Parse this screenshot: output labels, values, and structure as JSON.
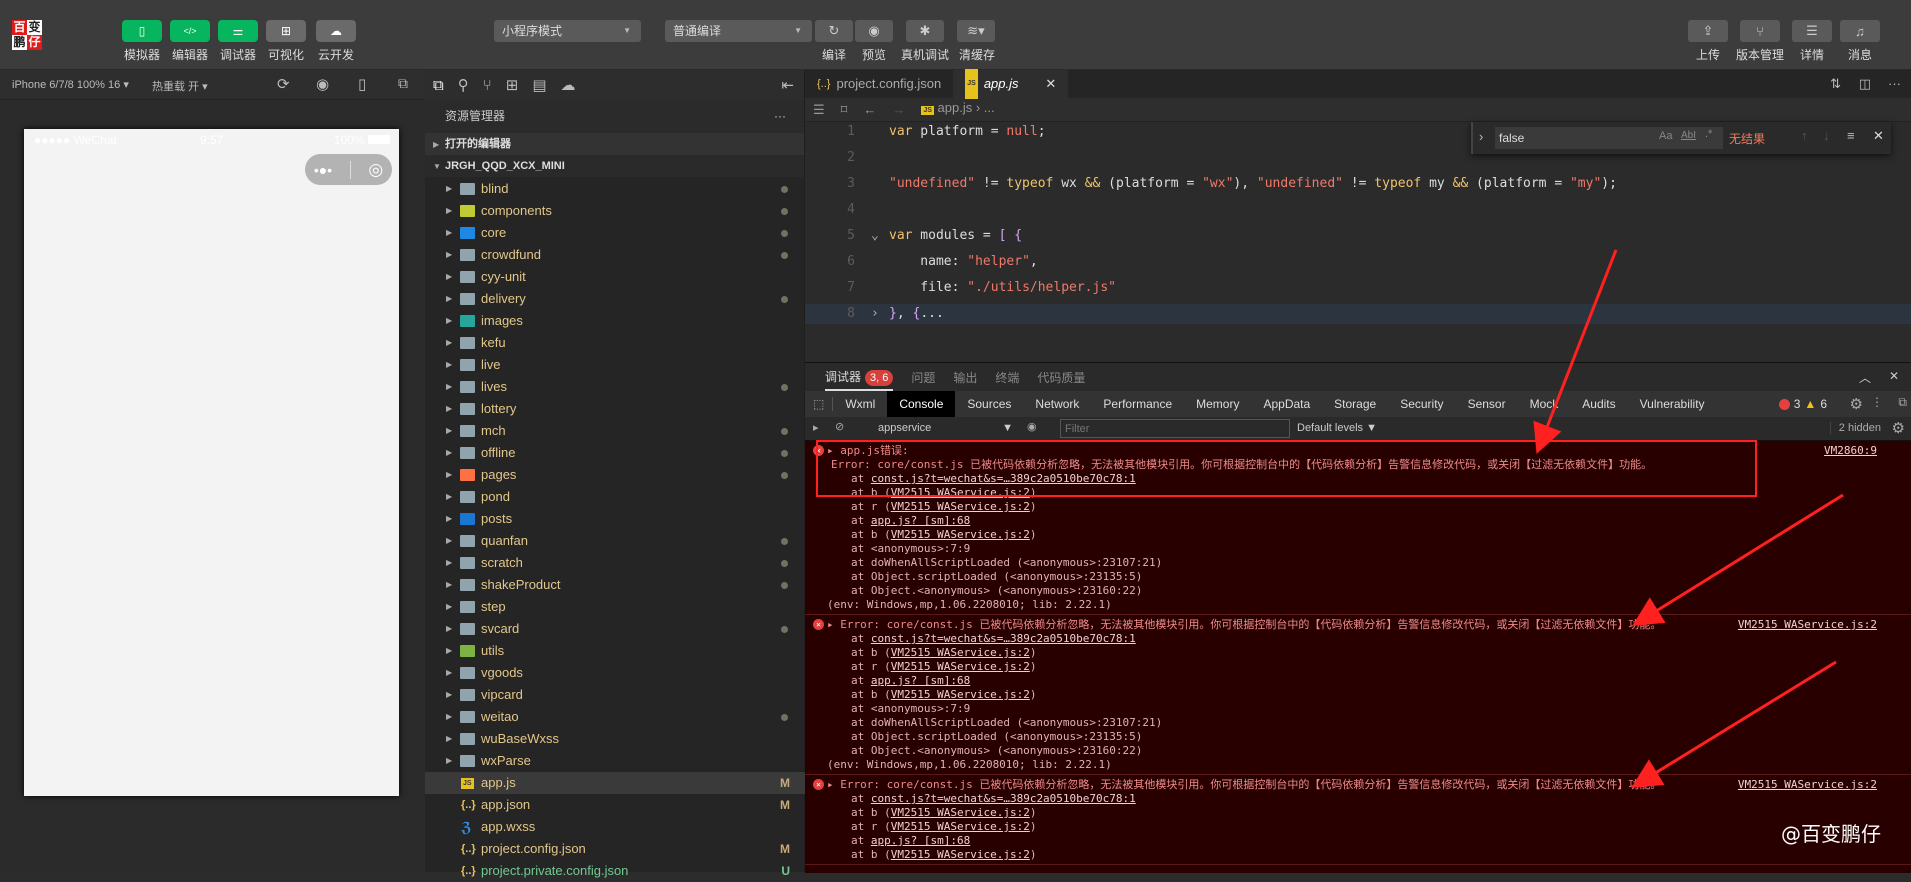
{
  "toolbar": {
    "logo_chars": [
      "百",
      "变",
      "鹏",
      "仔"
    ],
    "left_buttons": [
      {
        "label": "模拟器",
        "icon": "phone-icon",
        "style": "green"
      },
      {
        "label": "编辑器",
        "icon": "code-icon",
        "style": "green"
      },
      {
        "label": "调试器",
        "icon": "sliders-icon",
        "style": "green"
      },
      {
        "label": "可视化",
        "icon": "layout-icon",
        "style": "gray"
      },
      {
        "label": "云开发",
        "icon": "cloud-icon",
        "style": "gray"
      }
    ],
    "mode_select": "小程序模式",
    "compile_select": "普通编译",
    "center_buttons": [
      {
        "label": "编译",
        "icon": "refresh-icon"
      },
      {
        "label": "预览",
        "icon": "eye-icon"
      },
      {
        "label": "真机调试",
        "icon": "bug-icon"
      },
      {
        "label": "清缓存",
        "icon": "layers-icon"
      }
    ],
    "right_buttons": [
      {
        "label": "上传",
        "icon": "upload-icon"
      },
      {
        "label": "版本管理",
        "icon": "branch-icon"
      },
      {
        "label": "详情",
        "icon": "menu-icon"
      },
      {
        "label": "消息",
        "icon": "bell-icon"
      }
    ]
  },
  "simulator": {
    "device": "iPhone 6/7/8 100% 16",
    "hot_reload": "热重载 开",
    "status_carrier": "●●●●● WeChat",
    "status_time": "9:57",
    "status_battery": "100%"
  },
  "explorer": {
    "title": "资源管理器",
    "more": "···",
    "open_editors": "打开的编辑器",
    "project": "JRGH_QQD_XCX_MINI",
    "items": [
      {
        "name": "blind",
        "type": "folder",
        "dot": true
      },
      {
        "name": "components",
        "type": "folder-components",
        "dot": true
      },
      {
        "name": "core",
        "type": "folder-core",
        "dot": true
      },
      {
        "name": "crowdfund",
        "type": "folder",
        "dot": true
      },
      {
        "name": "cyy-unit",
        "type": "folder",
        "dot": false
      },
      {
        "name": "delivery",
        "type": "folder",
        "dot": true
      },
      {
        "name": "images",
        "type": "folder-images",
        "dot": false
      },
      {
        "name": "kefu",
        "type": "folder",
        "dot": false
      },
      {
        "name": "live",
        "type": "folder",
        "dot": false
      },
      {
        "name": "lives",
        "type": "folder",
        "dot": true
      },
      {
        "name": "lottery",
        "type": "folder",
        "dot": false
      },
      {
        "name": "mch",
        "type": "folder",
        "dot": true
      },
      {
        "name": "offline",
        "type": "folder",
        "dot": true
      },
      {
        "name": "pages",
        "type": "folder-pages",
        "dot": true
      },
      {
        "name": "pond",
        "type": "folder",
        "dot": false
      },
      {
        "name": "posts",
        "type": "folder-posts",
        "dot": false
      },
      {
        "name": "quanfan",
        "type": "folder",
        "dot": true
      },
      {
        "name": "scratch",
        "type": "folder",
        "dot": true
      },
      {
        "name": "shakeProduct",
        "type": "folder",
        "dot": true
      },
      {
        "name": "step",
        "type": "folder",
        "dot": false
      },
      {
        "name": "svcard",
        "type": "folder",
        "dot": true
      },
      {
        "name": "utils",
        "type": "folder-utils",
        "dot": false
      },
      {
        "name": "vgoods",
        "type": "folder",
        "dot": false
      },
      {
        "name": "vipcard",
        "type": "folder",
        "dot": false
      },
      {
        "name": "weitao",
        "type": "folder",
        "dot": true
      },
      {
        "name": "wuBaseWxss",
        "type": "folder",
        "dot": false
      },
      {
        "name": "wxParse",
        "type": "folder",
        "dot": false
      },
      {
        "name": "app.js",
        "type": "js",
        "flag": "M",
        "selected": true
      },
      {
        "name": "app.json",
        "type": "json",
        "flag": "M"
      },
      {
        "name": "app.wxss",
        "type": "css",
        "flag": ""
      },
      {
        "name": "project.config.json",
        "type": "json",
        "flag": "M"
      },
      {
        "name": "project.private.config.json",
        "type": "json",
        "flag": "U"
      }
    ]
  },
  "editor": {
    "tabs": [
      {
        "label": "project.config.json",
        "icon": "json-file-icon",
        "active": false
      },
      {
        "label": "app.js",
        "icon": "js-file-icon",
        "active": true
      }
    ],
    "breadcrumb": [
      "app.js",
      "..."
    ],
    "find": {
      "value": "false",
      "result": "无结果",
      "opt_case": "Aa",
      "opt_word": "AbI",
      "opt_regex": ".*"
    },
    "lines": [
      {
        "n": "1",
        "tokens": [
          [
            "kw",
            "var"
          ],
          [
            "pun",
            " platform = "
          ],
          [
            "nul",
            "null"
          ],
          [
            "pun",
            ";"
          ]
        ]
      },
      {
        "n": "2",
        "tokens": []
      },
      {
        "n": "3",
        "tokens": [
          [
            "str",
            "\"undefined\""
          ],
          [
            "pun",
            " != "
          ],
          [
            "kw",
            "typeof"
          ],
          [
            "pun",
            " wx "
          ],
          [
            "kw",
            "&&"
          ],
          [
            "pun",
            " ("
          ],
          [
            "pun",
            "platform = "
          ],
          [
            "str",
            "\"wx\""
          ],
          [
            "pun",
            "), "
          ],
          [
            "str",
            "\"undefined\""
          ],
          [
            "pun",
            " != "
          ],
          [
            "kw",
            "typeof"
          ],
          [
            "pun",
            " my "
          ],
          [
            "kw",
            "&&"
          ],
          [
            "pun",
            " (platform = "
          ],
          [
            "str",
            "\"my\""
          ],
          [
            "pun",
            ");"
          ]
        ]
      },
      {
        "n": "4",
        "tokens": []
      },
      {
        "n": "5",
        "tokens": [
          [
            "kw",
            "var"
          ],
          [
            "pun",
            " modules = "
          ],
          [
            "brk",
            "[ {"
          ]
        ]
      },
      {
        "n": "6",
        "tokens": [
          [
            "pun",
            "    name: "
          ],
          [
            "str",
            "\"helper\""
          ],
          [
            "pun",
            ","
          ]
        ]
      },
      {
        "n": "7",
        "tokens": [
          [
            "pun",
            "    file: "
          ],
          [
            "str",
            "\"./utils/helper.js\""
          ]
        ]
      },
      {
        "n": "8",
        "tokens": [
          [
            "brk",
            "}"
          ],
          [
            "pun",
            ", "
          ],
          [
            "brk",
            "{"
          ],
          [
            "pun",
            "..."
          ]
        ]
      }
    ]
  },
  "devtools": {
    "panel_tabs": [
      {
        "label": "调试器",
        "badge": "3, 6",
        "active": true
      },
      {
        "label": "问题"
      },
      {
        "label": "输出"
      },
      {
        "label": "终端"
      },
      {
        "label": "代码质量"
      }
    ],
    "tabs": [
      "Wxml",
      "Console",
      "Sources",
      "Network",
      "Performance",
      "Memory",
      "AppData",
      "Storage",
      "Security",
      "Sensor",
      "Mock",
      "Audits",
      "Vulnerability"
    ],
    "active_tab": "Console",
    "error_count": "3",
    "warning_count": "6",
    "context": "appservice",
    "filter_placeholder": "Filter",
    "levels": "Default levels ▼",
    "hidden": "2 hidden",
    "messages": [
      {
        "header": "app.js错误:",
        "error": "Error: core/const.js 已被代码依赖分析忽略，无法被其他模块引用。你可根据控制台中的【代码依赖分析】告警信息修改代码，或关闭【过滤无依赖文件】功能。",
        "source": "VM2860:9",
        "stack": [
          [
            "at ",
            "const.js?t=wechat&s=…389c2a0510be70c78:1",
            ""
          ],
          [
            "at b (",
            "VM2515 WAService.js:2",
            ")"
          ],
          [
            "at r (",
            "VM2515 WAService.js:2",
            ")"
          ],
          [
            "at ",
            "app.js? [sm]:68",
            ""
          ],
          [
            "at b (",
            "VM2515 WAService.js:2",
            ")"
          ],
          [
            "at <anonymous>:7:9",
            "",
            ""
          ],
          [
            "at doWhenAllScriptLoaded (<anonymous>:23107:21)",
            "",
            ""
          ],
          [
            "at Object.scriptLoaded (<anonymous>:23135:5)",
            "",
            ""
          ],
          [
            "at Object.<anonymous> (<anonymous>:23160:22)",
            "",
            ""
          ]
        ],
        "env": "(env: Windows,mp,1.06.2208010; lib: 2.22.1)"
      },
      {
        "header": "",
        "error": "Error: core/const.js 已被代码依赖分析忽略，无法被其他模块引用。你可根据控制台中的【代码依赖分析】告警信息修改代码，或关闭【过滤无依赖文件】功能。",
        "source": "VM2515 WAService.js:2",
        "stack": [
          [
            "at ",
            "const.js?t=wechat&s=…389c2a0510be70c78:1",
            ""
          ],
          [
            "at b (",
            "VM2515 WAService.js:2",
            ")"
          ],
          [
            "at r (",
            "VM2515 WAService.js:2",
            ")"
          ],
          [
            "at ",
            "app.js? [sm]:68",
            ""
          ],
          [
            "at b (",
            "VM2515 WAService.js:2",
            ")"
          ],
          [
            "at <anonymous>:7:9",
            "",
            ""
          ],
          [
            "at doWhenAllScriptLoaded (<anonymous>:23107:21)",
            "",
            ""
          ],
          [
            "at Object.scriptLoaded (<anonymous>:23135:5)",
            "",
            ""
          ],
          [
            "at Object.<anonymous> (<anonymous>:23160:22)",
            "",
            ""
          ]
        ],
        "env": "(env: Windows,mp,1.06.2208010; lib: 2.22.1)"
      },
      {
        "header": "",
        "error": "Error: core/const.js 已被代码依赖分析忽略，无法被其他模块引用。你可根据控制台中的【代码依赖分析】告警信息修改代码，或关闭【过滤无依赖文件】功能。",
        "source": "VM2515 WAService.js:2",
        "stack": [
          [
            "at ",
            "const.js?t=wechat&s=…389c2a0510be70c78:1",
            ""
          ],
          [
            "at b (",
            "VM2515 WAService.js:2",
            ")"
          ],
          [
            "at r (",
            "VM2515 WAService.js:2",
            ")"
          ],
          [
            "at ",
            "app.js? [sm]:68",
            ""
          ],
          [
            "at b (",
            "VM2515 WAService.js:2",
            ")"
          ]
        ],
        "env": ""
      }
    ]
  },
  "watermark": "@百变鹏仔",
  "colors": {
    "accent_green": "#07b55e",
    "error_red": "#e5403d",
    "annotation_red": "#ff2020",
    "console_bg": "#290000"
  }
}
